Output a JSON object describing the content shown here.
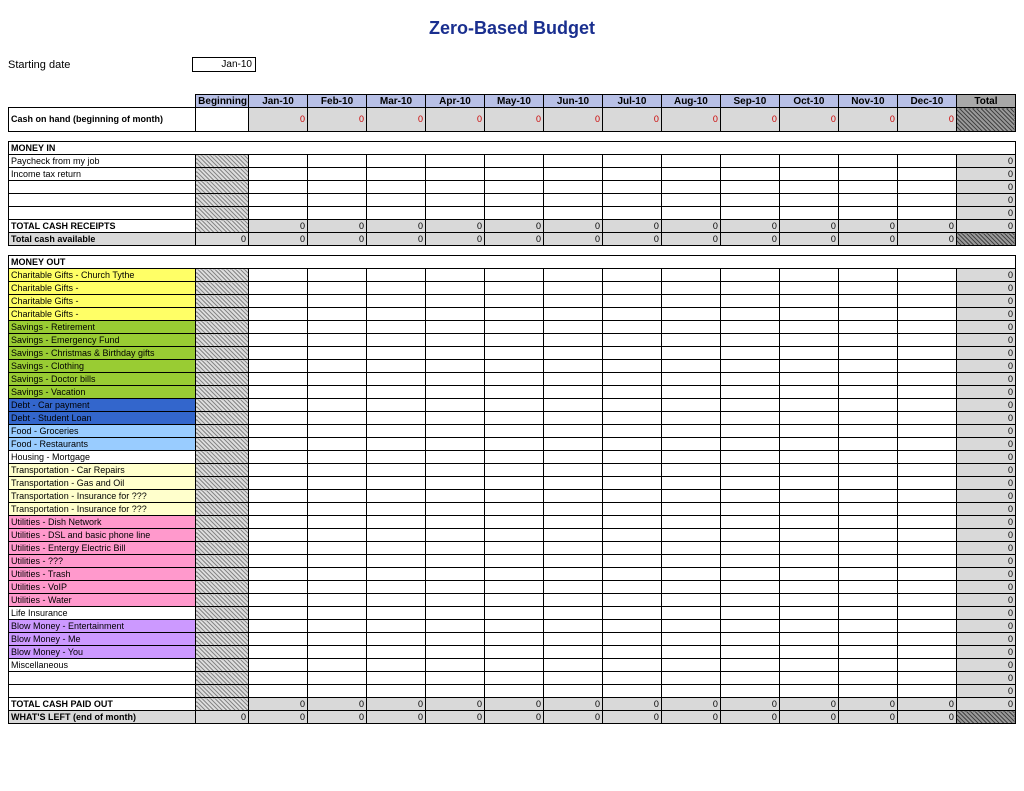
{
  "title": "Zero-Based Budget",
  "starting": {
    "label": "Starting date",
    "value": "Jan-10"
  },
  "columns": [
    "Beginning",
    "Jan-10",
    "Feb-10",
    "Mar-10",
    "Apr-10",
    "May-10",
    "Jun-10",
    "Jul-10",
    "Aug-10",
    "Sep-10",
    "Oct-10",
    "Nov-10",
    "Dec-10",
    "Total"
  ],
  "cash_on_hand": {
    "label": "Cash on hand (beginning of month)",
    "values": [
      "",
      "0",
      "0",
      "0",
      "0",
      "0",
      "0",
      "0",
      "0",
      "0",
      "0",
      "0",
      "0",
      ""
    ]
  },
  "money_in_label": "MONEY IN",
  "money_in": [
    {
      "label": "Paycheck from my job",
      "total": "0"
    },
    {
      "label": "Income tax return",
      "total": "0"
    },
    {
      "label": "",
      "total": "0"
    },
    {
      "label": "",
      "total": "0"
    },
    {
      "label": "",
      "total": "0"
    }
  ],
  "total_receipts": {
    "label": "TOTAL CASH RECEIPTS",
    "values": [
      "",
      "0",
      "0",
      "0",
      "0",
      "0",
      "0",
      "0",
      "0",
      "0",
      "0",
      "0",
      "0",
      "0"
    ]
  },
  "total_available": {
    "label": "Total cash available",
    "values": [
      "0",
      "0",
      "0",
      "0",
      "0",
      "0",
      "0",
      "0",
      "0",
      "0",
      "0",
      "0",
      "0",
      ""
    ]
  },
  "money_out_label": "MONEY OUT",
  "money_out": [
    {
      "label": "Charitable Gifts - Church Tythe",
      "color": "yellow",
      "total": "0"
    },
    {
      "label": "Charitable Gifts -",
      "color": "yellow",
      "total": "0"
    },
    {
      "label": "Charitable Gifts -",
      "color": "yellow",
      "total": "0"
    },
    {
      "label": "Charitable Gifts -",
      "color": "yellow",
      "total": "0"
    },
    {
      "label": "Savings - Retirement",
      "color": "green",
      "total": "0"
    },
    {
      "label": "Savings - Emergency Fund",
      "color": "green",
      "total": "0"
    },
    {
      "label": "Savings - Christmas & Birthday gifts",
      "color": "green",
      "total": "0"
    },
    {
      "label": "Savings - Clothing",
      "color": "green",
      "total": "0"
    },
    {
      "label": "Savings - Doctor bills",
      "color": "green",
      "total": "0"
    },
    {
      "label": "Savings - Vacation",
      "color": "green",
      "total": "0"
    },
    {
      "label": "Debt - Car payment",
      "color": "blue",
      "total": "0"
    },
    {
      "label": "Debt - Student Loan",
      "color": "blue",
      "total": "0"
    },
    {
      "label": "Food - Groceries",
      "color": "lblue",
      "total": "0"
    },
    {
      "label": "Food - Restaurants",
      "color": "lblue",
      "total": "0"
    },
    {
      "label": "Housing - Mortgage",
      "color": "white",
      "total": "0"
    },
    {
      "label": "Transportation - Car Repairs",
      "color": "lyel",
      "total": "0"
    },
    {
      "label": "Transportation - Gas and Oil",
      "color": "lyel",
      "total": "0"
    },
    {
      "label": "Transportation - Insurance for ???",
      "color": "lyel",
      "total": "0"
    },
    {
      "label": "Transportation - Insurance for ???",
      "color": "lyel",
      "total": "0"
    },
    {
      "label": "Utilities - Dish Network",
      "color": "pink",
      "total": "0"
    },
    {
      "label": "Utilities - DSL and basic phone line",
      "color": "pink",
      "total": "0"
    },
    {
      "label": "Utilities - Entergy Electric Bill",
      "color": "pink",
      "total": "0"
    },
    {
      "label": "Utilities - ???",
      "color": "pink",
      "total": "0"
    },
    {
      "label": "Utilities - Trash",
      "color": "pink",
      "total": "0"
    },
    {
      "label": "Utilities - VoIP",
      "color": "pink",
      "total": "0"
    },
    {
      "label": "Utilities - Water",
      "color": "pink",
      "total": "0"
    },
    {
      "label": "Life Insurance",
      "color": "white",
      "total": "0"
    },
    {
      "label": "Blow Money - Entertainment",
      "color": "purple",
      "total": "0"
    },
    {
      "label": "Blow Money - Me",
      "color": "purple",
      "total": "0"
    },
    {
      "label": "Blow Money - You",
      "color": "purple",
      "total": "0"
    },
    {
      "label": "Miscellaneous",
      "color": "white",
      "total": "0"
    },
    {
      "label": "",
      "color": "white",
      "total": "0"
    },
    {
      "label": "",
      "color": "white",
      "total": "0"
    }
  ],
  "total_paid": {
    "label": "TOTAL CASH PAID OUT",
    "values": [
      "",
      "0",
      "0",
      "0",
      "0",
      "0",
      "0",
      "0",
      "0",
      "0",
      "0",
      "0",
      "0",
      "0"
    ]
  },
  "whats_left": {
    "label": "WHAT'S LEFT (end of month)",
    "values": [
      "0",
      "0",
      "0",
      "0",
      "0",
      "0",
      "0",
      "0",
      "0",
      "0",
      "0",
      "0",
      "0",
      ""
    ]
  }
}
